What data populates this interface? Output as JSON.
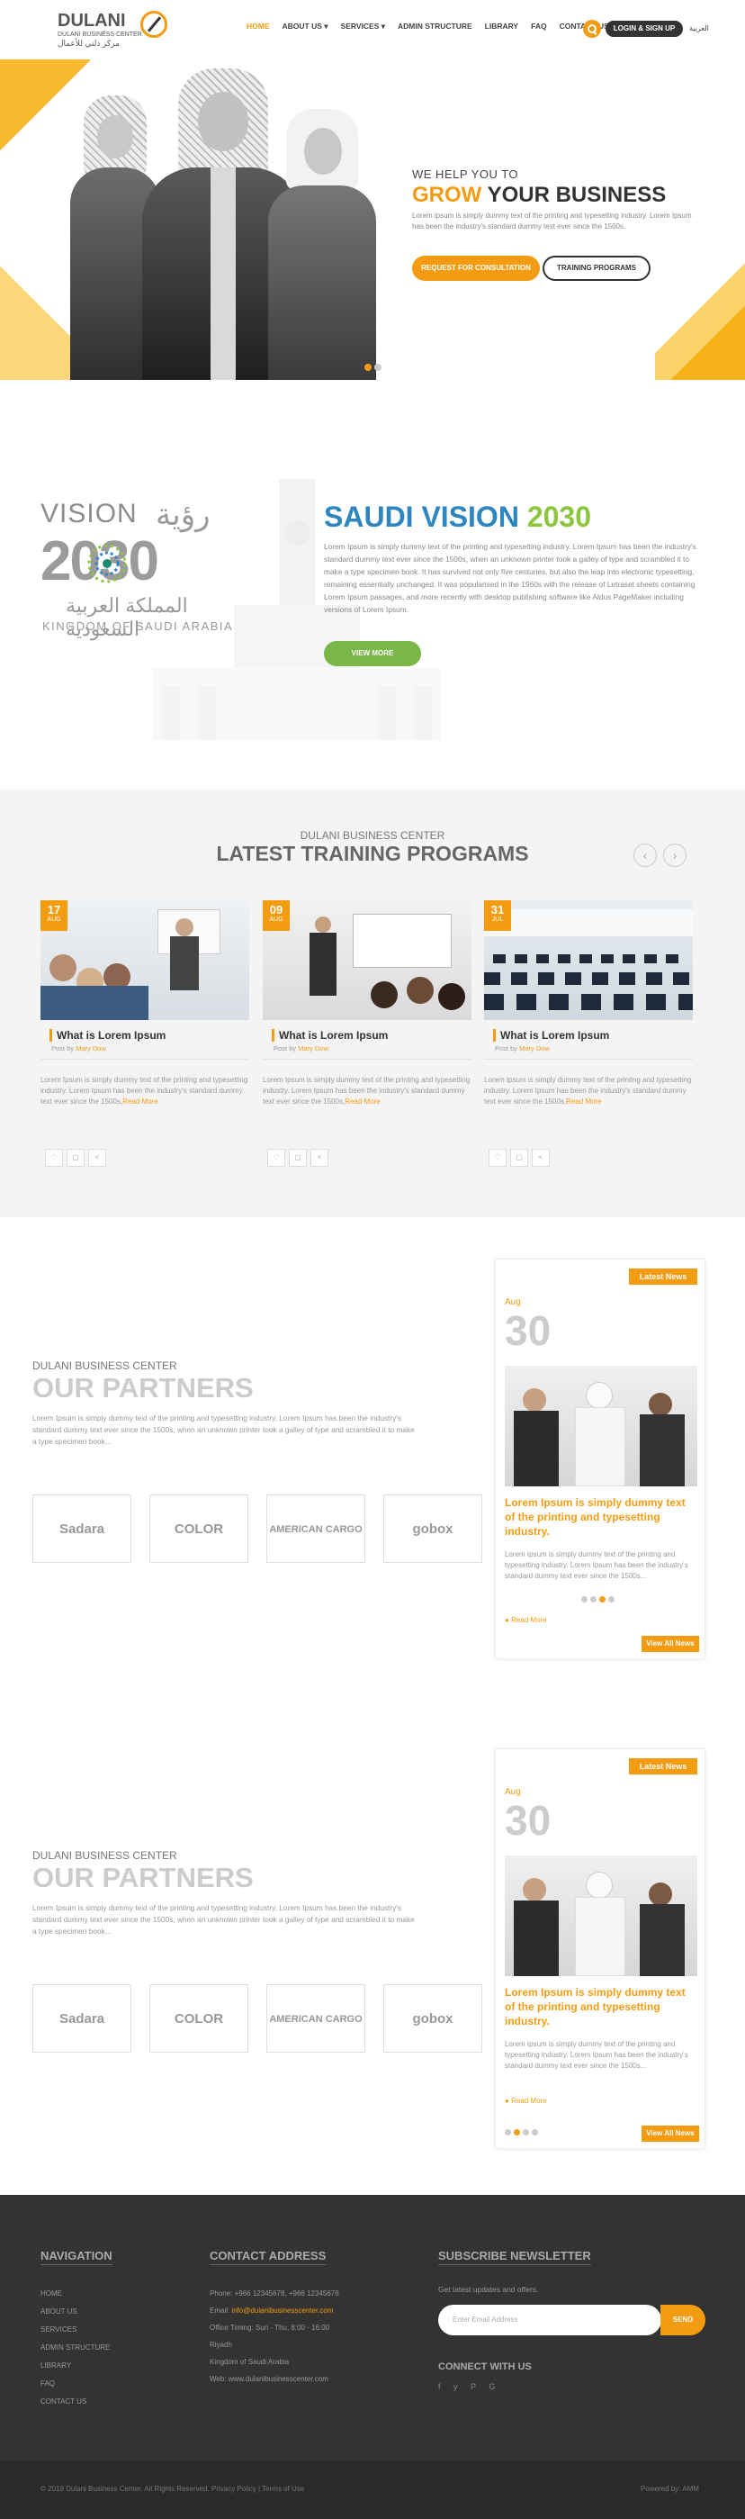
{
  "header": {
    "logo": {
      "name": "DULANI",
      "subtitle": "DULANI BUSINESS CENTER",
      "arabic": "مركز دلني للأعمال"
    },
    "nav": [
      "HOME",
      "ABOUT US ▾",
      "SERVICES ▾",
      "ADMIN STRUCTURE",
      "LIBRARY",
      "FAQ",
      "CONTACT US"
    ],
    "login_label": "LOGIN & SIGN UP",
    "lang_label": "العربية"
  },
  "hero": {
    "kicker": "WE HELP YOU TO",
    "title_highlight": "GROW",
    "title_rest": " YOUR BUSINESS",
    "description": "Lorem ipsum is simply dummy text of the printing and typesetting industry. Lorem Ipsum has been the industry's standard dummy text ever since the 1500s.",
    "btn_primary": "REQUEST FOR CONSULTATION",
    "btn_secondary": "TRAINING PROGRAMS",
    "slider_active": 1,
    "slider_total": 2
  },
  "vision": {
    "logo_vision": "VISION",
    "logo_arabic_top": "رؤية",
    "logo_year": "2030",
    "logo_arabic_bottom": "المملكة العربية السعودية",
    "logo_kingdom": "KINGDOM OF SAUDI ARABIA",
    "title_part1": "SAUDI VISION ",
    "title_part2": "2030",
    "description": "Lorem Ipsum is simply dummy text of the printing and typesetting industry. Lorem Ipsum has been the industry's standard dummy text ever since the 1500s, when an unknown printer took a galley of type and scrambled it to make a type specimen book. It has survived not only five centuries, but also the leap into electronic typesetting, remaining essentially unchanged. It was popularised in the 1960s with the release of Letraset sheets containing Lorem Ipsum passages, and more recently with desktop publishing software like Aldus PageMaker including versions of Lorem Ipsum.",
    "button": "VIEW MORE"
  },
  "training": {
    "kicker": "DULANI BUSINESS CENTER",
    "title": "LATEST TRAINING PROGRAMS",
    "prev": "‹",
    "next": "›",
    "cards": [
      {
        "day": "17",
        "month": "AUG",
        "title": "What is Lorem Ipsum",
        "meta_prefix": "Post by ",
        "author": "Mary Dow",
        "desc": "Lorem Ipsum is simply dummy text of the printing and typesetting industry. Lorem Ipsum has been the industry's standard dummy text ever since the 1500s,",
        "read_more": "Read More"
      },
      {
        "day": "09",
        "month": "AUG",
        "title": "What is Lorem Ipsum",
        "meta_prefix": "Post by ",
        "author": "Mary Dow",
        "desc": "Lorem Ipsum is simply dummy text of the printing and typesetting industry. Lorem Ipsum has been the industry's standard dummy text ever since the 1500s,",
        "read_more": "Read More"
      },
      {
        "day": "31",
        "month": "JUL",
        "title": "What is Lorem Ipsum",
        "meta_prefix": "Post by ",
        "author": "Mary Dow",
        "desc": "Lorem Ipsum is simply dummy text of the printing and typesetting industry. Lorem Ipsum has been the industry's standard dummy text ever since the 1500s,",
        "read_more": "Read More"
      }
    ],
    "icon_counts": [
      "10",
      "10"
    ]
  },
  "partners": {
    "kicker": "DULANI BUSINESS CENTER",
    "title": "OUR PARTNERS",
    "description": "Lorem Ipsum is simply dummy text of the printing and typesetting industry. Lorem Ipsum has been the industry's standard dummy text ever since the 1500s, when an unknown printer took a galley of type and scrambled it to make a type specimen book...",
    "logos": [
      "Sadara",
      "COLOR",
      "AMERICAN CARGO",
      "gobox"
    ]
  },
  "news": {
    "badge": "Latest News",
    "month": "Aug",
    "day": "30",
    "title": "Lorem Ipsum is simply dummy text of the printing and typesetting industry.",
    "desc": "Lorem Ipsum is simply dummy text of the printing and typesetting industry. Lorem Ipsum has been the industry's standard dummy text ever since the 1500s...",
    "read_more": "Read More",
    "view_all": "View All News"
  },
  "footer": {
    "nav_title": "NAVIGATION",
    "nav_items": [
      "HOME",
      "ABOUT US",
      "SERVICES",
      "ADMIN STRUCTURE",
      "LIBRARY",
      "FAQ",
      "CONTACT US"
    ],
    "contact_title": "CONTACT ADDRESS",
    "contact": {
      "phone": "Phone: +966 12345678, +966 12345678",
      "email_prefix": "Email: ",
      "email": "info@dulanibusinesscenter.com",
      "timing": "Office Timing: Sun - Thu, 8:00 - 16:00",
      "city": "Riyadh",
      "country": "Kingdom of Saudi Arabia",
      "web": "Web: www.dulanibusinesscenter.com"
    },
    "subscribe_title": "SUBSCRIBE NEWSLETTER",
    "subscribe_desc": "Get latest updates and offers.",
    "email_placeholder": "Enter Email Address",
    "send_label": "SEND",
    "connect_title": "CONNECT WITH US",
    "social": "f  y  P  G",
    "copyright": "© 2018 Dulani Business Center. All Rights Reserved. Privacy Policy | Terms of Use",
    "powered": "Powered by: AMM"
  }
}
